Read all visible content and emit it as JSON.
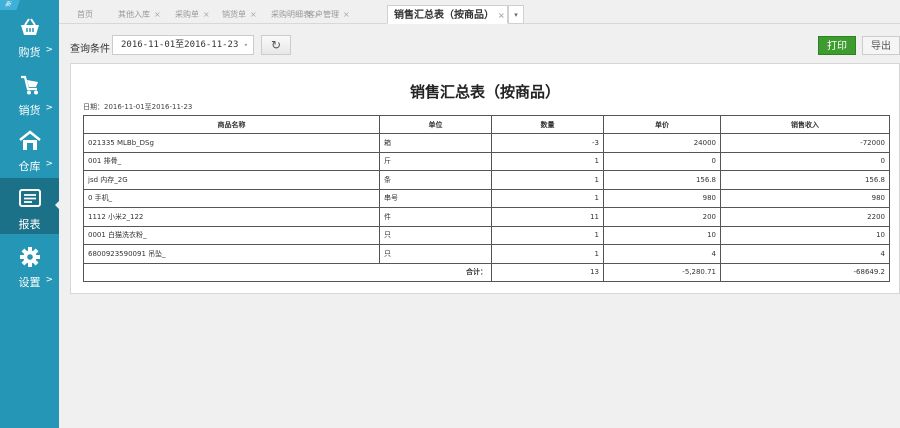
{
  "sidebar": {
    "corner_tag": "新",
    "items": [
      {
        "label": "购货",
        "icon": "basket-icon"
      },
      {
        "label": "销货",
        "icon": "cart-icon"
      },
      {
        "label": "仓库",
        "icon": "warehouse-icon"
      },
      {
        "label": "报表",
        "icon": "report-icon"
      },
      {
        "label": "设置",
        "icon": "gear-icon"
      }
    ],
    "arrow": ">",
    "active_index": 3
  },
  "tabs": [
    {
      "label": "首页",
      "closable": false
    },
    {
      "label": "其他入库",
      "closable": true
    },
    {
      "label": "采购单",
      "closable": true
    },
    {
      "label": "销货单",
      "closable": true
    },
    {
      "label": "采购明细表",
      "closable": true
    },
    {
      "label": "客户管理",
      "closable": true
    },
    {
      "label": "销售汇总表（按商品）",
      "closable": true,
      "active": true
    }
  ],
  "tab_close_glyph": "×",
  "tab_dropdown_glyph": "▾",
  "query": {
    "label": "查询条件",
    "date_range": "2016-11-01至2016-11-23",
    "dropdown_glyph": "▾",
    "refresh_glyph": "↻"
  },
  "toolbar": {
    "print": "打印",
    "export": "导出"
  },
  "report": {
    "title": "销售汇总表（按商品）",
    "date_line": "日期：2016-11-01至2016-11-23",
    "columns": [
      "商品名称",
      "单位",
      "数量",
      "单价",
      "销售收入"
    ],
    "rows": [
      [
        "021335 MLBb_DSg",
        "箱",
        "-3",
        "24000",
        "-72000"
      ],
      [
        "001 排骨_",
        "斤",
        "1",
        "0",
        "0"
      ],
      [
        "jsd 内存_2G",
        "条",
        "1",
        "156.8",
        "156.8"
      ],
      [
        "0 手机_",
        "串号",
        "1",
        "980",
        "980"
      ],
      [
        "1112 小米2_122",
        "件",
        "11",
        "200",
        "2200"
      ],
      [
        "0001 白猫洗衣粉_",
        "只",
        "1",
        "10",
        "10"
      ],
      [
        "6800923590091 吊坠_",
        "只",
        "1",
        "4",
        "4"
      ]
    ],
    "totals": {
      "label": "合计：",
      "qty": "13",
      "price": "-5,280.71",
      "revenue": "-68649.2"
    }
  },
  "colors": {
    "sidebar": "#2596b5",
    "sidebar_active": "#1b7188",
    "print_button": "#3d9b2f"
  }
}
